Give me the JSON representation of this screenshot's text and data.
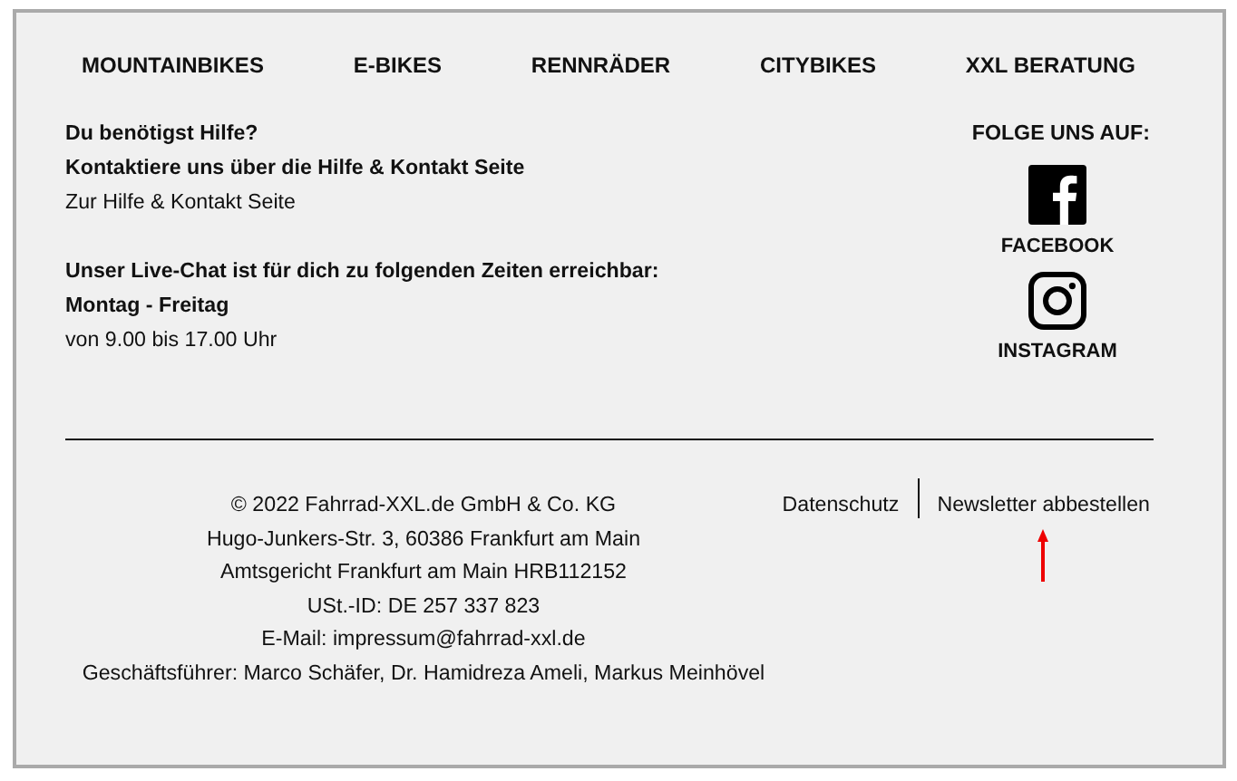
{
  "nav": [
    "MOUNTAINBIKES",
    "E-BIKES",
    "RENNRÄDER",
    "CITYBIKES",
    "XXL BERATUNG"
  ],
  "help": {
    "title": "Du benötigst Hilfe?",
    "subtitle": "Kontaktiere uns über die Hilfe & Kontakt Seite",
    "link": "Zur Hilfe & Kontakt Seite"
  },
  "live_chat": {
    "title": "Unser Live-Chat ist für dich zu folgenden Zeiten erreichbar:",
    "days": "Montag - Freitag",
    "hours": "von 9.00 bis 17.00 Uhr"
  },
  "social": {
    "heading": "FOLGE UNS AUF:",
    "items": [
      {
        "kind": "facebook",
        "label": "FACEBOOK"
      },
      {
        "kind": "instagram",
        "label": "INSTAGRAM"
      }
    ]
  },
  "imprint": [
    "© 2022 Fahrrad-XXL.de GmbH & Co. KG",
    "Hugo-Junkers-Str. 3, 60386 Frankfurt am Main",
    "Amtsgericht Frankfurt am Main HRB112152",
    "USt.-ID: DE 257 337 823",
    "E-Mail: impressum@fahrrad-xxl.de",
    "Geschäftsführer: Marco Schäfer, Dr. Hamidreza Ameli, Markus Meinhövel"
  ],
  "legal_links": [
    "Datenschutz",
    "Newsletter abbestellen"
  ]
}
